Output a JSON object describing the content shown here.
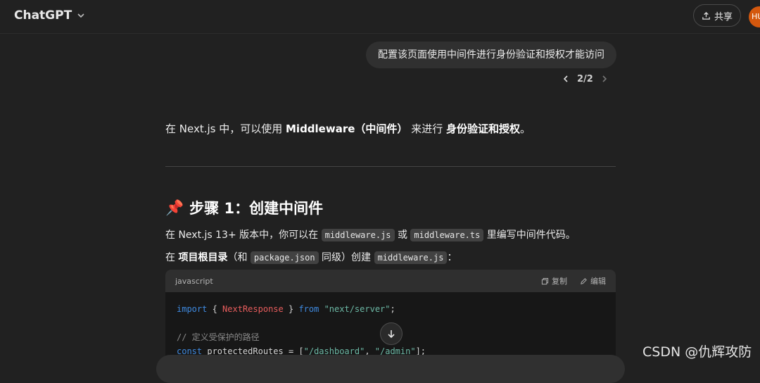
{
  "header": {
    "model_name": "ChatGPT",
    "share_label": "共享",
    "avatar_initials": "HU"
  },
  "user_message": {
    "text": "配置该页面使用中间件进行身份验证和授权才能访问",
    "pager": "2/2"
  },
  "assistant": {
    "intro": {
      "p1": "在 Next.js 中，可以使用 ",
      "b1": "Middleware（中间件）",
      "p2": " 来进行 ",
      "b2": "身份验证和授权",
      "p3": "。"
    },
    "step_icon": "📌",
    "step_title": "步骤 1：创建中间件",
    "para1": {
      "t1": "在 Next.js 13+ 版本中，你可以在 ",
      "c1": "middleware.js",
      "t2": " 或 ",
      "c2": "middleware.ts",
      "t3": " 里编写中间件代码。"
    },
    "para2": {
      "t1": "在 ",
      "b1": "项目根目录",
      "t2": "（和 ",
      "c1": "package.json",
      "t3": " 同级）创建 ",
      "c2": "middleware.js",
      "t4": "："
    },
    "code": {
      "language": "javascript",
      "copy_label": "复制",
      "edit_label": "编辑",
      "line1": {
        "kw1": "import",
        "p1": " { ",
        "cls": "NextResponse",
        "p2": " } ",
        "kw2": "from",
        "p3": " ",
        "str": "\"next/server\"",
        "p4": ";"
      },
      "comment": "// 定义受保护的路径",
      "line3": {
        "kw": "const",
        "p1": " protectedRoutes = [",
        "s1": "\"/dashboard\"",
        "p2": ", ",
        "s2": "\"/admin\"",
        "p3": "];"
      }
    }
  },
  "watermark": "CSDN @仇辉攻防",
  "colors": {
    "background": "#212121",
    "bubble": "#303030",
    "avatar": "#d4580e",
    "keyword": "#3f8ae0",
    "class_name": "#e85d5d",
    "string": "#6cb8a5"
  }
}
